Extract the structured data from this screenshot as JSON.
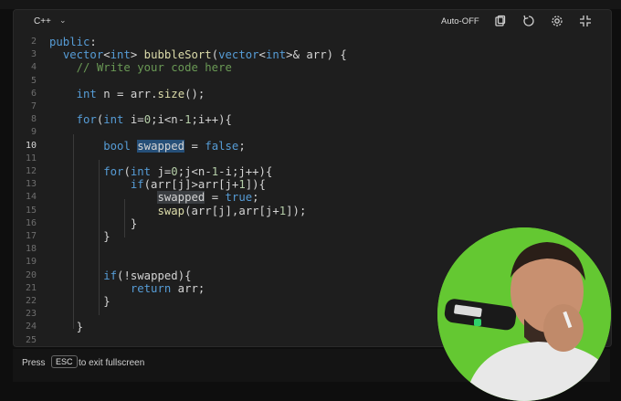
{
  "toolbar": {
    "language": "C++",
    "auto_label": "Auto-OFF",
    "icons": [
      "copy-icon",
      "reset-icon",
      "settings-icon",
      "exit-fullscreen-icon"
    ]
  },
  "code_lines": [
    {
      "n": "2",
      "t": "public:"
    },
    {
      "n": "3",
      "t": "  vector<int> bubbleSort(vector<int>& arr) {"
    },
    {
      "n": "4",
      "t": "    // Write your code here"
    },
    {
      "n": "5",
      "t": ""
    },
    {
      "n": "6",
      "t": "    int n = arr.size();"
    },
    {
      "n": "7",
      "t": ""
    },
    {
      "n": "8",
      "t": "    for(int i=0;i<n-1;i++){"
    },
    {
      "n": "9",
      "t": ""
    },
    {
      "n": "10",
      "t": "        bool swapped = false;"
    },
    {
      "n": "11",
      "t": ""
    },
    {
      "n": "12",
      "t": "        for(int j=0;j<n-1-i;j++){"
    },
    {
      "n": "13",
      "t": "            if(arr[j]>arr[j+1]){"
    },
    {
      "n": "14",
      "t": "                swapped = true;"
    },
    {
      "n": "15",
      "t": "                swap(arr[j],arr[j+1]);"
    },
    {
      "n": "16",
      "t": "            }"
    },
    {
      "n": "17",
      "t": "        }"
    },
    {
      "n": "18",
      "t": ""
    },
    {
      "n": "19",
      "t": ""
    },
    {
      "n": "20",
      "t": "        if(!swapped){"
    },
    {
      "n": "21",
      "t": "            return arr;"
    },
    {
      "n": "22",
      "t": "        }"
    },
    {
      "n": "23",
      "t": ""
    },
    {
      "n": "24",
      "t": "    }"
    },
    {
      "n": "25",
      "t": ""
    }
  ],
  "footer": {
    "press": "Press",
    "key": "ESC",
    "exit_text": "to exit fullscreen"
  },
  "colors": {
    "editor_bg": "#1e1e1e",
    "keyword": "#569cd6",
    "function": "#dcdcaa",
    "comment": "#6a9955",
    "selection": "#264f78",
    "webcam_bg": "#64c832"
  }
}
